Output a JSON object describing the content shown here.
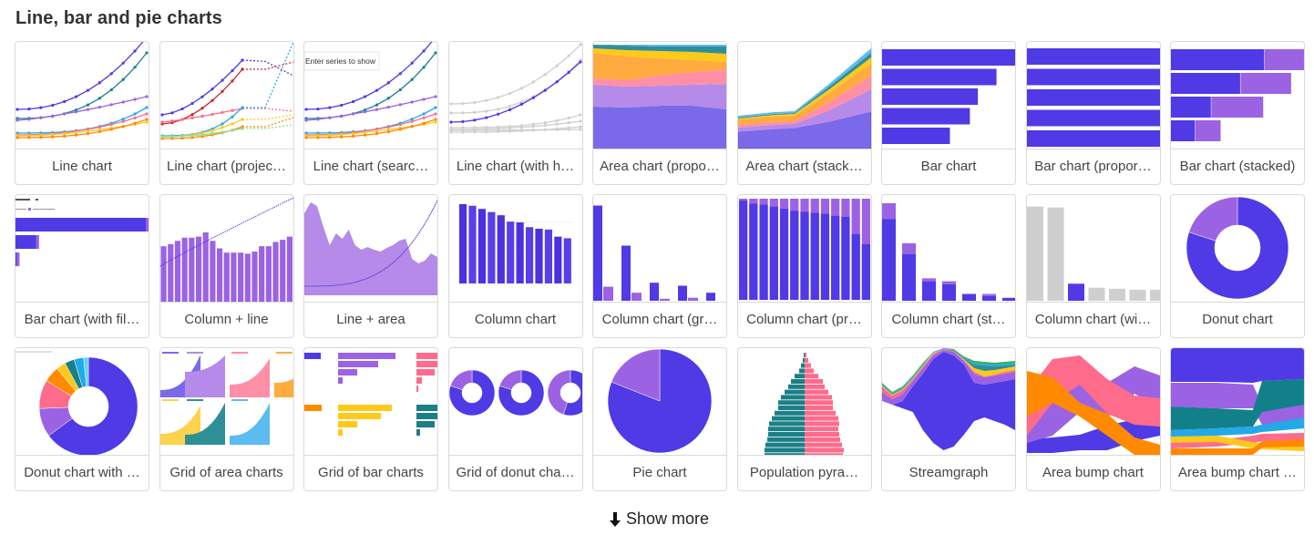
{
  "section": {
    "title": "Line, bar and pie charts"
  },
  "colors": {
    "indigo": "#4f3ae6",
    "purple": "#9b63e3",
    "lilac": "#b58ae8",
    "teal": "#1b7f86",
    "pink": "#ff6b8a",
    "orange": "#ff8a00",
    "amber": "#ffab40",
    "yellow": "#ffc91a",
    "sky": "#23a9e8",
    "red": "#c4262e",
    "green": "#8fe08f",
    "grey": "#cfcfcf"
  },
  "cards": [
    {
      "label": "Line chart",
      "thumb": "line-multi"
    },
    {
      "label": "Line chart (projec…",
      "thumb": "line-projection"
    },
    {
      "label": "Line chart (searc…",
      "thumb": "line-search",
      "overlay_text": "Enter series to show"
    },
    {
      "label": "Line chart (with h…",
      "thumb": "line-highlight"
    },
    {
      "label": "Area chart (propo…",
      "thumb": "area-proportional"
    },
    {
      "label": "Area chart (stack…",
      "thumb": "area-stacked"
    },
    {
      "label": "Bar chart",
      "thumb": "bar",
      "values": [
        100,
        86,
        72,
        66,
        51
      ]
    },
    {
      "label": "Bar chart (propor…",
      "thumb": "bar-proportional"
    },
    {
      "label": "Bar chart (stacked)",
      "thumb": "bar-stacked",
      "values": [
        [
          70,
          30
        ],
        [
          52,
          38
        ],
        [
          30,
          39
        ],
        [
          18,
          19
        ]
      ]
    },
    {
      "label": "Bar chart (with fil…",
      "thumb": "bar-filter",
      "values": [
        100,
        16,
        1
      ]
    },
    {
      "label": "Column + line",
      "thumb": "column-line",
      "values": [
        52,
        54,
        57,
        60,
        60,
        61,
        65,
        57,
        50,
        46,
        46,
        46,
        45,
        47,
        52,
        52,
        56,
        58,
        61
      ]
    },
    {
      "label": "Line + area",
      "thumb": "line-area"
    },
    {
      "label": "Column chart",
      "thumb": "column",
      "values": [
        100,
        98,
        94,
        90,
        86,
        78,
        77,
        71,
        69,
        68,
        59,
        57
      ]
    },
    {
      "label": "Column chart (gr…",
      "thumb": "column-grouped",
      "values": [
        [
          95,
          14
        ],
        [
          55,
          8
        ],
        [
          18,
          2
        ],
        [
          15,
          3
        ],
        [
          8,
          0
        ]
      ]
    },
    {
      "label": "Column chart (pr…",
      "thumb": "column-proportional",
      "values": [
        98,
        95,
        94,
        92,
        90,
        88,
        87,
        86,
        85,
        83,
        82,
        65,
        55
      ]
    },
    {
      "label": "Column chart (st…",
      "thumb": "column-stacked",
      "values": [
        [
          84,
          16
        ],
        [
          48,
          11
        ],
        [
          20,
          3
        ],
        [
          17,
          3
        ],
        [
          7,
          0
        ],
        [
          5,
          2
        ],
        [
          3,
          0
        ]
      ]
    },
    {
      "label": "Column chart (wi…",
      "thumb": "column-highlight",
      "values": [
        94,
        93,
        17,
        13,
        12,
        11,
        11
      ],
      "highlight_index": 2
    },
    {
      "label": "Donut chart",
      "thumb": "donut",
      "values": [
        80,
        20
      ]
    },
    {
      "label": "Donut chart with …",
      "thumb": "donut-multi",
      "values": [
        62,
        9,
        9,
        5,
        3,
        3,
        3,
        1.5
      ]
    },
    {
      "label": "Grid of area charts",
      "thumb": "grid-area"
    },
    {
      "label": "Grid of bar charts",
      "thumb": "grid-bar"
    },
    {
      "label": "Grid of donut cha…",
      "thumb": "grid-donut",
      "values": [
        [
          80,
          20
        ],
        [
          80,
          20
        ],
        [
          55,
          45
        ]
      ]
    },
    {
      "label": "Pie chart",
      "thumb": "pie",
      "values": [
        81,
        19
      ]
    },
    {
      "label": "Population pyra…",
      "thumb": "pyramid"
    },
    {
      "label": "Streamgraph",
      "thumb": "streamgraph"
    },
    {
      "label": "Area bump chart",
      "thumb": "area-bump"
    },
    {
      "label": "Area bump chart …",
      "thumb": "area-bump-2"
    }
  ],
  "show_more": {
    "label": "Show more",
    "icon": "arrow-down-icon"
  }
}
